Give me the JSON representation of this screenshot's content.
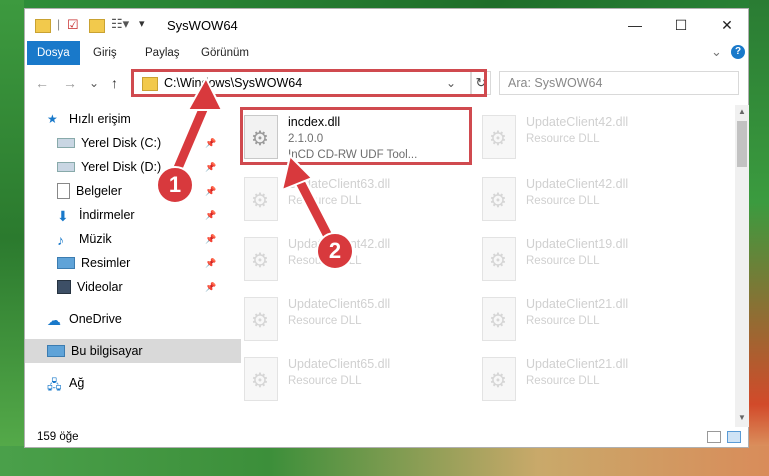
{
  "window": {
    "title": "SysWOW64",
    "minimize": "—",
    "maximize": "☐",
    "close": "✕"
  },
  "ribbon": {
    "tabs": [
      "Dosya",
      "Giriş",
      "Paylaş",
      "Görünüm"
    ],
    "expand": "⌄",
    "help": "?"
  },
  "nav": {
    "back": "←",
    "forward": "→",
    "recent": "⌄",
    "up": "↑",
    "refresh": "↻",
    "dropdown": "⌄"
  },
  "address": {
    "path": "C:\\Windows\\SysWOW64"
  },
  "search": {
    "placeholder": "Ara: SysWOW64"
  },
  "sidebar": {
    "items": [
      {
        "label": "Hızlı erişim",
        "icon": "star-icon",
        "pinned": false
      },
      {
        "label": "Yerel Disk (C:)",
        "icon": "drive-icon",
        "pinned": true
      },
      {
        "label": "Yerel Disk (D:)",
        "icon": "drive-icon",
        "pinned": true
      },
      {
        "label": "Belgeler",
        "icon": "document-icon",
        "pinned": true
      },
      {
        "label": "İndirmeler",
        "icon": "download-icon",
        "pinned": true
      },
      {
        "label": "Müzik",
        "icon": "music-icon",
        "pinned": true
      },
      {
        "label": "Resimler",
        "icon": "pictures-icon",
        "pinned": true
      },
      {
        "label": "Videolar",
        "icon": "video-icon",
        "pinned": true
      },
      {
        "label": "OneDrive",
        "icon": "cloud-icon",
        "pinned": false
      },
      {
        "label": "Bu bilgisayar",
        "icon": "computer-icon",
        "pinned": false
      },
      {
        "label": "Ağ",
        "icon": "network-icon",
        "pinned": false
      }
    ]
  },
  "files": {
    "highlight": {
      "name": "incdex.dll",
      "version": "2.1.0.0",
      "desc": "InCD CD-RW UDF Tool..."
    },
    "others": [
      {
        "name": "UpdateClient42.dll",
        "desc": "Resource DLL"
      },
      {
        "name": "UpdateClient63.dll",
        "desc": "Resource DLL"
      },
      {
        "name": "UpdateClient42.dll",
        "desc": "Resource DLL"
      },
      {
        "name": "UpdateClient42.dll",
        "desc": "Resource DLL"
      },
      {
        "name": "UpdateClient19.dll",
        "desc": "Resource DLL"
      },
      {
        "name": "UpdateClient65.dll",
        "desc": "Resource DLL"
      },
      {
        "name": "UpdateClient21.dll",
        "desc": "Resource DLL"
      },
      {
        "name": "UpdateClient65.dll",
        "desc": "Resource DLL"
      },
      {
        "name": "UpdateClient21.dll",
        "desc": "Resource DLL"
      }
    ]
  },
  "status": {
    "count": "159 öğe"
  },
  "markers": {
    "one": "1",
    "two": "2"
  },
  "colors": {
    "accent": "#1979ca",
    "annotation": "#d04a4f"
  }
}
